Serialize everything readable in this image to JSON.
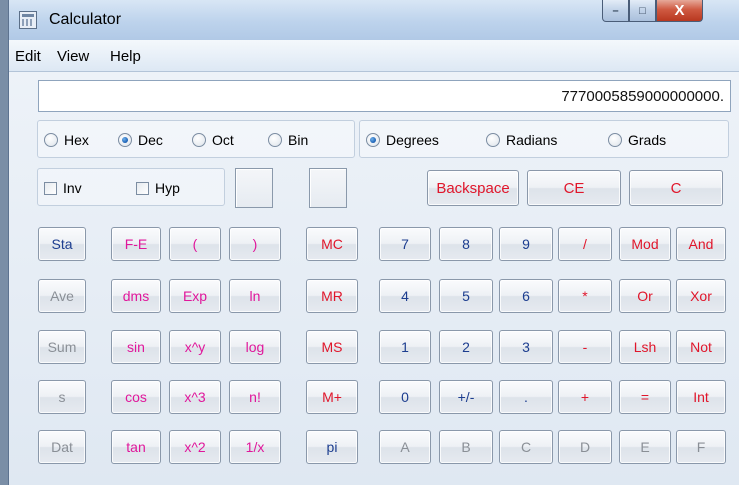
{
  "window": {
    "title": "Calculator",
    "controls": {
      "minimize": "–",
      "maximize": "□",
      "close": "X"
    }
  },
  "menu": [
    "Edit",
    "View",
    "Help"
  ],
  "display": {
    "value": "7770005859000000000."
  },
  "base": {
    "options": [
      "Hex",
      "Dec",
      "Oct",
      "Bin"
    ],
    "selected": "Dec"
  },
  "angle": {
    "options": [
      "Degrees",
      "Radians",
      "Grads"
    ],
    "selected": "Degrees"
  },
  "checkboxes": [
    {
      "label": "Inv",
      "checked": false
    },
    {
      "label": "Hyp",
      "checked": false
    }
  ],
  "top_keys": [
    "Backspace",
    "CE",
    "C"
  ],
  "keys": {
    "col_stats": [
      "Sta",
      "Ave",
      "Sum",
      "s",
      "Dat"
    ],
    "col_sci1": [
      "F-E",
      "dms",
      "sin",
      "cos",
      "tan"
    ],
    "col_sci2": [
      "(",
      "Exp",
      "x^y",
      "x^3",
      "x^2"
    ],
    "col_sci3": [
      ")",
      "ln",
      "log",
      "n!",
      "1/x"
    ],
    "col_mem": [
      "MC",
      "MR",
      "MS",
      "M+",
      "pi"
    ],
    "row_1": [
      "7",
      "8",
      "9",
      "/",
      "Mod",
      "And"
    ],
    "row_2": [
      "4",
      "5",
      "6",
      "*",
      "Or",
      "Xor"
    ],
    "row_3": [
      "1",
      "2",
      "3",
      "-",
      "Lsh",
      "Not"
    ],
    "row_4": [
      "0",
      "+/-",
      ".",
      "+",
      "=",
      "Int"
    ],
    "row_5": [
      "A",
      "B",
      "C",
      "D",
      "E",
      "F"
    ]
  },
  "colors": {
    "blue_text": "#1c3d8f",
    "magenta_text": "#e0179b",
    "red_text": "#e0162b",
    "disabled_text": "#8a8f96"
  }
}
